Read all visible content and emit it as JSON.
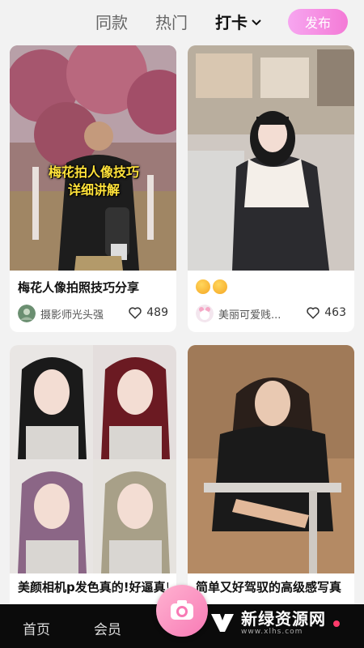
{
  "tabs": {
    "same": "同款",
    "hot": "热门",
    "checkin": "打卡"
  },
  "publish_label": "发布",
  "cards": [
    {
      "title": "梅花人像拍照技巧分享",
      "overlay_line1": "梅花拍人像技巧",
      "overlay_line2": "详细讲解",
      "author": "摄影师光头强",
      "likes": "489"
    },
    {
      "title": "",
      "author": "美丽可爱贱...",
      "likes": "463"
    },
    {
      "title": "美颜相机p发色真的!好逼真!!"
    },
    {
      "title": "简单又好驾驭的高级感写真"
    }
  ],
  "nav": {
    "home": "首页",
    "vip": "会员"
  },
  "watermark": {
    "name": "新绿资源网",
    "url": "www.xlhs.com"
  },
  "colors": {
    "accent": "#f47ad6",
    "nav_bg": "#0b0b0b",
    "overlay_text": "#ffe23a"
  }
}
